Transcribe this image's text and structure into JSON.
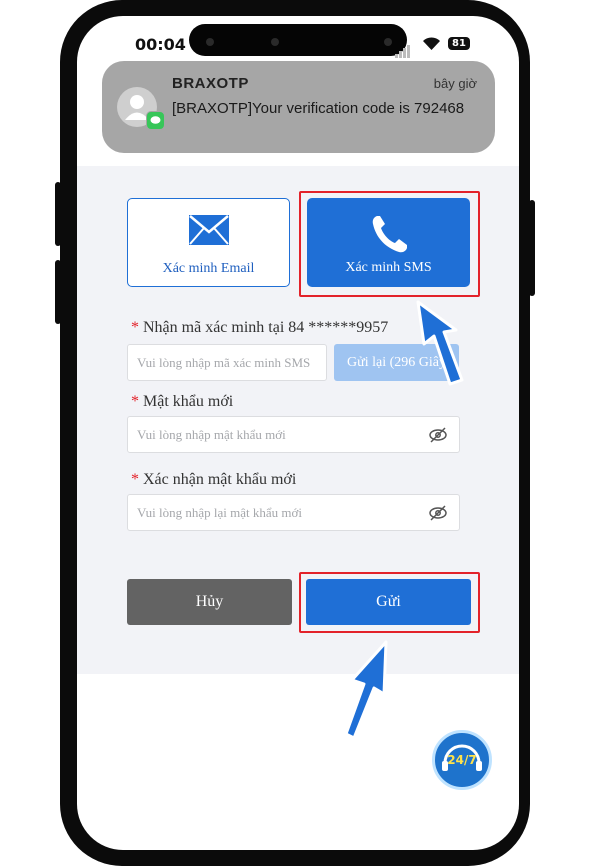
{
  "status_bar": {
    "time": "00:04",
    "battery": "81"
  },
  "notification": {
    "sender": "BRAXOTP",
    "time": "bây giờ",
    "message": "[BRAXOTP]Your verification code is 792468"
  },
  "tabs": {
    "email_label": "Xác minh Email",
    "sms_label": "Xác minh SMS"
  },
  "form": {
    "code_label": "Nhận mã xác minh tại 84 ******9957",
    "code_placeholder": "Vui lòng nhập mã xác minh SMS",
    "resend_label": "Gửi lại (296 Giây)",
    "new_password_label": "Mật khẩu mới",
    "new_password_placeholder": "Vui lòng nhập mật khẩu mới",
    "confirm_password_label": "Xác nhận mật khẩu mới",
    "confirm_password_placeholder": "Vui lòng nhập lại mật khẩu mới",
    "required_mark": "*"
  },
  "actions": {
    "cancel_label": "Hủy",
    "submit_label": "Gửi"
  },
  "support": {
    "label": "24/7"
  },
  "colors": {
    "primary": "#1f6fd6",
    "highlight": "#e3222a",
    "cancel": "#636363",
    "disabled": "#9fc4f1"
  }
}
